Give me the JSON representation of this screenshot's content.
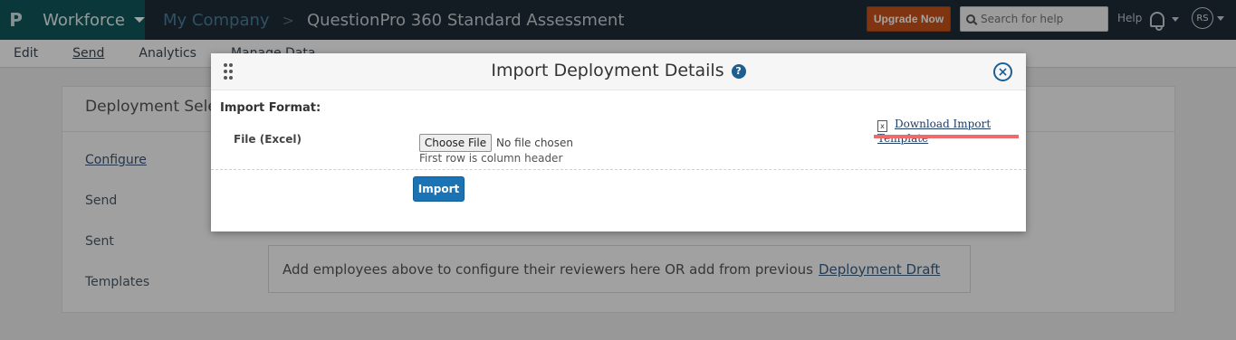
{
  "topbar": {
    "logo_glyph": "P",
    "workspace": "Workforce",
    "company": "My Company",
    "separator": ">",
    "survey": "QuestionPro 360 Standard Assessment",
    "upgrade_label": "Upgrade Now",
    "search_placeholder": "Search for help",
    "help_label": "Help",
    "avatar_initials": "RS",
    "colors": {
      "bar": "#1f2d36",
      "brand": "#11585b",
      "upgrade": "#c8531a"
    }
  },
  "submenu": {
    "items": [
      {
        "label": "Edit"
      },
      {
        "label": "Send",
        "active": true
      },
      {
        "label": "Analytics"
      },
      {
        "label": "Manage Data"
      }
    ]
  },
  "background": {
    "panel_title": "Deployment Selection",
    "sidebar": [
      "Configure",
      "Send",
      "Sent",
      "Templates"
    ],
    "draft_text": "Add employees above to configure their reviewers here OR add from previous",
    "draft_link": "Deployment Draft"
  },
  "modal": {
    "title": "Import Deployment Details",
    "help_glyph": "?",
    "close_glyph": "×",
    "import_format_label": "Import Format:",
    "download_link": "Download Import Template",
    "file_label": "File (Excel)",
    "choose_file_label": "Choose File",
    "no_file_text": "No file chosen",
    "hint": "First row is column header",
    "import_button": "Import",
    "icons": [
      "drag-handle-icon",
      "help-icon",
      "close-icon",
      "excel-file-icon"
    ],
    "colors": {
      "primary": "#1a73b4",
      "highlight": "#ef6b6b"
    }
  }
}
